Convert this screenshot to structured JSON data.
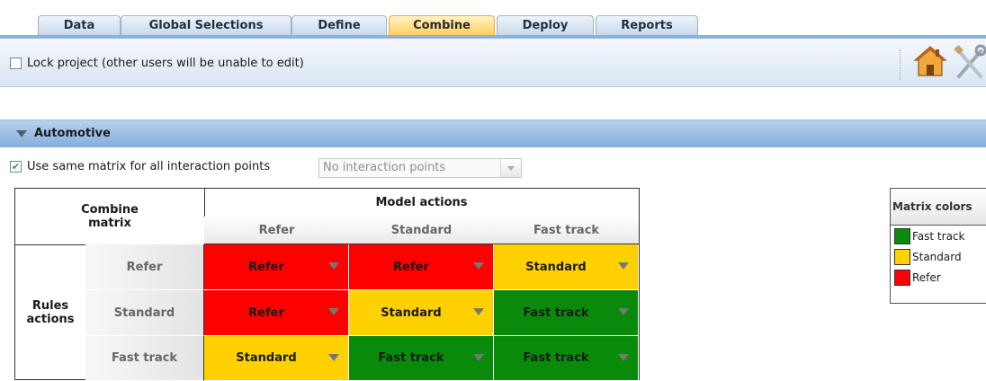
{
  "tabs": [
    {
      "label": "Data",
      "active": false
    },
    {
      "label": "Global Selections",
      "active": false
    },
    {
      "label": "Define",
      "active": false
    },
    {
      "label": "Combine",
      "active": true
    },
    {
      "label": "Deploy",
      "active": false
    },
    {
      "label": "Reports",
      "active": false
    }
  ],
  "toolbar": {
    "lock_label": "Lock project (other users will be unable to edit)",
    "lock_checked": false,
    "icons": [
      "home-icon",
      "tools-icon"
    ]
  },
  "section": {
    "title": "Automotive",
    "same_matrix_label": "Use same matrix for all interaction points",
    "same_matrix_checked": true,
    "interaction_points_placeholder": "No interaction points"
  },
  "matrix": {
    "corner_line1": "Combine",
    "corner_line2": "matrix",
    "model_actions_label": "Model actions",
    "rules_actions_line1": "Rules",
    "rules_actions_line2": "actions",
    "columns": [
      "Refer",
      "Standard",
      "Fast track"
    ],
    "rows": [
      {
        "label": "Refer",
        "cells": [
          "Refer",
          "Refer",
          "Standard"
        ]
      },
      {
        "label": "Standard",
        "cells": [
          "Refer",
          "Standard",
          "Fast track"
        ]
      },
      {
        "label": "Fast track",
        "cells": [
          "Standard",
          "Fast track",
          "Fast track"
        ]
      }
    ]
  },
  "legend": {
    "title": "Matrix colors",
    "items": [
      {
        "label": "Fast track",
        "color": "#0a8a0a"
      },
      {
        "label": "Standard",
        "color": "#ffd100"
      },
      {
        "label": "Refer",
        "color": "#ff0000"
      }
    ]
  },
  "colors": {
    "Refer": "#ff0000",
    "Standard": "#ffd100",
    "Fast track": "#0a8a0a"
  }
}
